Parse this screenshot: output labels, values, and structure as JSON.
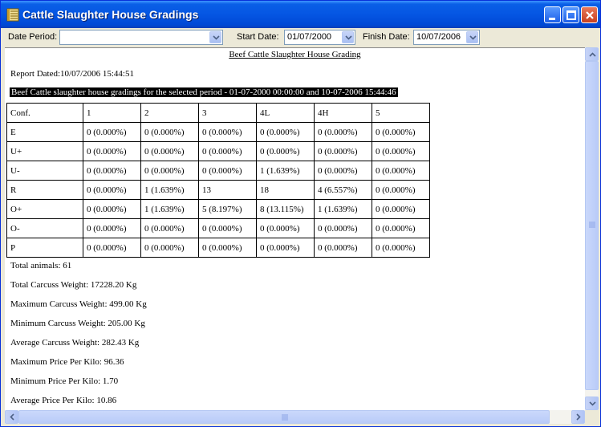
{
  "window": {
    "title": "Cattle Slaughter House Gradings"
  },
  "toolbar": {
    "date_period_label": "Date Period:",
    "date_period_value": "",
    "start_date_label": "Start Date:",
    "start_date_value": "01/07/2000",
    "finish_date_label": "Finish Date:",
    "finish_date_value": "10/07/2006"
  },
  "report": {
    "title": "Beef Cattle Slaughter House Grading",
    "dated": "Report Dated:10/07/2006 15:44:51",
    "period": "Beef Cattle slaughter house gradings for the selected period - 01-07-2000 00:00:00 and 10-07-2006 15:44:46",
    "table": {
      "header": [
        "Conf.",
        "1",
        "2",
        "3",
        "4L",
        "4H",
        "5"
      ],
      "rows": [
        [
          "E",
          "0 (0.000%)",
          "0 (0.000%)",
          "0 (0.000%)",
          "0 (0.000%)",
          "0 (0.000%)",
          "0 (0.000%)"
        ],
        [
          "U+",
          "0 (0.000%)",
          "0 (0.000%)",
          "0 (0.000%)",
          "0 (0.000%)",
          "0 (0.000%)",
          "0 (0.000%)"
        ],
        [
          "U-",
          "0 (0.000%)",
          "0 (0.000%)",
          "0 (0.000%)",
          "1 (1.639%)",
          "0 (0.000%)",
          "0 (0.000%)"
        ],
        [
          "R",
          "0 (0.000%)",
          "1 (1.639%)",
          "13",
          "18",
          "4 (6.557%)",
          "0 (0.000%)"
        ],
        [
          "O+",
          "0 (0.000%)",
          "1 (1.639%)",
          "5 (8.197%)",
          "8 (13.115%)",
          "1 (1.639%)",
          "0 (0.000%)"
        ],
        [
          "O-",
          "0 (0.000%)",
          "0 (0.000%)",
          "0 (0.000%)",
          "0 (0.000%)",
          "0 (0.000%)",
          "0 (0.000%)"
        ],
        [
          "P",
          "0 (0.000%)",
          "0 (0.000%)",
          "0 (0.000%)",
          "0 (0.000%)",
          "0 (0.000%)",
          "0 (0.000%)"
        ]
      ]
    },
    "stats": [
      "Total animals: 61",
      "Total Carcuss Weight: 17228.20 Kg",
      "Maximum Carcuss Weight: 499.00 Kg",
      "Minimum Carcuss Weight: 205.00 Kg",
      "Average Carcuss Weight: 282.43 Kg",
      "Maximum Price Per Kilo: 96.36",
      "Minimum Price Per Kilo: 1.70",
      "Average Price Per Kilo: 10.86"
    ]
  },
  "icons": {
    "app": "ledger-icon",
    "minimize": "minimize-icon",
    "maximize": "maximize-icon",
    "close": "close-icon",
    "dropdown": "chevron-down-icon"
  },
  "colors": {
    "titlebar": "#0556e3",
    "period_bg": "#000000",
    "period_fg": "#ffffff"
  }
}
